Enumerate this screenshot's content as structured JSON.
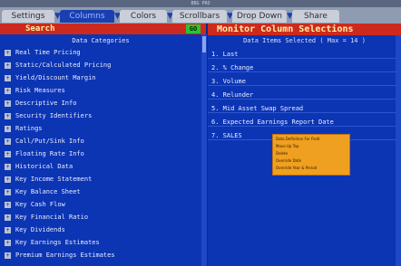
{
  "window": {
    "title": "BBG PRO"
  },
  "tabs": [
    {
      "label": "Settings"
    },
    {
      "label": "Columns"
    },
    {
      "label": "Colors"
    },
    {
      "label": "Scrollbars"
    },
    {
      "label": "Drop Down"
    },
    {
      "label": "Share"
    }
  ],
  "search": {
    "label": "Search",
    "go_label": "GO"
  },
  "right_panel": {
    "title": "Monitor Column Selections",
    "header": "Data Items Selected ( Max = 14 )"
  },
  "left_panel": {
    "header": "Data Categories",
    "categories": [
      "Real Time Pricing",
      "Static/Calculated Pricing",
      "Yield/Discount Margin",
      "Risk Measures",
      "Descriptive Info",
      "Security Identifiers",
      "Ratings",
      "Call/Put/Sink Info",
      "Floating Rate Info",
      "Historical Data",
      "Key Income Statement",
      "Key Balance Sheet",
      "Key Cash Flow",
      "Key Financial Ratio",
      "Key Dividends",
      "Key Earnings Estimates",
      "Premium Earnings Estimates"
    ]
  },
  "selected_items": [
    "1. Last",
    "2. % Change",
    "3. Volume",
    "4. Relunder",
    "5. Mid Asset Swap Spread",
    "6. Expected Earnings Report Date",
    "7. SALES"
  ],
  "context_menu": {
    "items": [
      "Data Definition For Field",
      "Move Up Top",
      "Delete",
      "Override Date",
      "Override Year & Period"
    ]
  },
  "colors": {
    "background": "#0c35b4",
    "header_red": "#cc2a1e",
    "title_yellow": "#fff2a0",
    "go_green": "#2fc22f",
    "menu_orange": "#f0a020"
  }
}
